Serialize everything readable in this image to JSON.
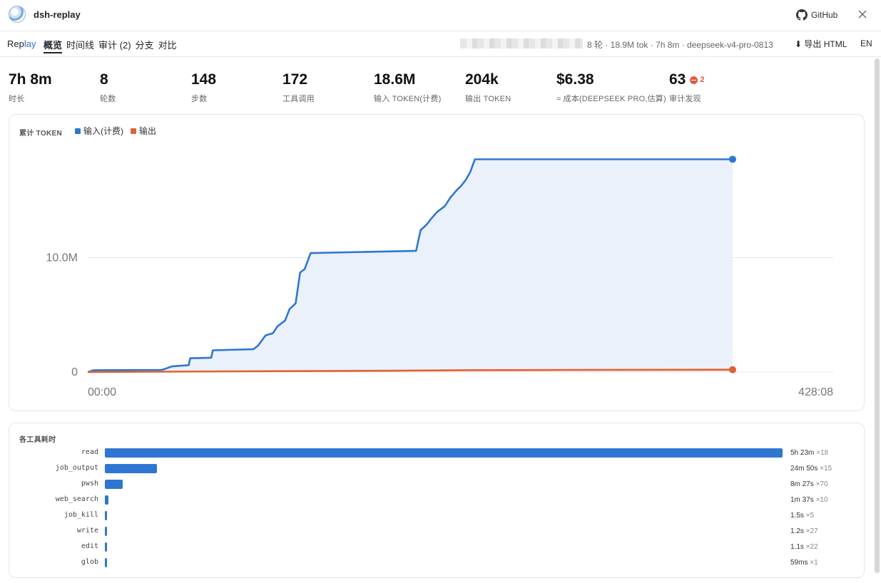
{
  "app": {
    "title": "dsh-replay",
    "github_label": "GitHub"
  },
  "nav": {
    "brand_prefix": "Rep",
    "brand_suffix": "lay",
    "tabs": [
      {
        "label": "概览",
        "active": true
      },
      {
        "label": "时间线",
        "active": false
      },
      {
        "label": "审计 (2)",
        "active": false
      },
      {
        "label": "分支",
        "active": false
      },
      {
        "label": "对比",
        "active": false
      }
    ],
    "session_info": "8 轮 · 18.9M tok · 7h 8m · deepseek-v4-pro-0813",
    "export_label": "⬇ 导出 HTML",
    "lang_label": "EN"
  },
  "stats": [
    {
      "value": "7h 8m",
      "label": "时长"
    },
    {
      "value": "8",
      "label": "轮数"
    },
    {
      "value": "148",
      "label": "步数"
    },
    {
      "value": "172",
      "label": "工具调用"
    },
    {
      "value": "18.6M",
      "label": "输入 TOKEN(计费)"
    },
    {
      "value": "204k",
      "label": "输出 TOKEN"
    },
    {
      "value": "$6.38",
      "label": "≈ 成本(DEEPSEEK PRO,估算)"
    },
    {
      "value": "63",
      "label": "审计发现",
      "badge": "2"
    }
  ],
  "chart_panel": {
    "title": "累计 TOKEN"
  },
  "chart_data": {
    "type": "area",
    "x_range_minutes": [
      0,
      428.133
    ],
    "x_tick_labels": [
      "00:00",
      "428:08"
    ],
    "y_range": [
      0,
      20000000
    ],
    "y_ticks": [
      0,
      10000000
    ],
    "y_tick_labels": [
      "0",
      "10.0M"
    ],
    "grid": true,
    "legend_placement": "top-left",
    "series": [
      {
        "name": "输入(计费)",
        "color": "#2f76d2",
        "fill": "#e8f0fa",
        "points": [
          [
            0,
            0
          ],
          [
            4,
            160000
          ],
          [
            49,
            190000
          ],
          [
            51,
            260000
          ],
          [
            56,
            500000
          ],
          [
            67,
            600000
          ],
          [
            68,
            1200000
          ],
          [
            82,
            1250000
          ],
          [
            83,
            1900000
          ],
          [
            110,
            2000000
          ],
          [
            113,
            2300000
          ],
          [
            118,
            3200000
          ],
          [
            123,
            3400000
          ],
          [
            126,
            4000000
          ],
          [
            131,
            4500000
          ],
          [
            134,
            5500000
          ],
          [
            138,
            6000000
          ],
          [
            141,
            8700000
          ],
          [
            144,
            9000000
          ],
          [
            148,
            10400000
          ],
          [
            218,
            10600000
          ],
          [
            221,
            12400000
          ],
          [
            225,
            12900000
          ],
          [
            228,
            13400000
          ],
          [
            232,
            14000000
          ],
          [
            237,
            14500000
          ],
          [
            241,
            15300000
          ],
          [
            245,
            15900000
          ],
          [
            248,
            16300000
          ],
          [
            251,
            16800000
          ],
          [
            254,
            17500000
          ],
          [
            257,
            18600000
          ],
          [
            428.133,
            18600000
          ]
        ]
      },
      {
        "name": "输出",
        "color": "#e06234",
        "fill": "#fbe9e3",
        "points": [
          [
            0,
            0
          ],
          [
            100,
            60000
          ],
          [
            200,
            110000
          ],
          [
            250,
            160000
          ],
          [
            340,
            190000
          ],
          [
            428.133,
            204000
          ]
        ]
      }
    ]
  },
  "tools_panel": {
    "title": "各工具耗时",
    "items": [
      {
        "name": "read",
        "seconds": 19380,
        "duration": "5h 23m",
        "count": "×18"
      },
      {
        "name": "job_output",
        "seconds": 1490,
        "duration": "24m 50s",
        "count": "×15"
      },
      {
        "name": "pwsh",
        "seconds": 507,
        "duration": "8m 27s",
        "count": "×70"
      },
      {
        "name": "web_search",
        "seconds": 97,
        "duration": "1m 37s",
        "count": "×10"
      },
      {
        "name": "job_kill",
        "seconds": 1.5,
        "duration": "1.5s",
        "count": "×5"
      },
      {
        "name": "write",
        "seconds": 1.2,
        "duration": "1.2s",
        "count": "×27"
      },
      {
        "name": "edit",
        "seconds": 1.1,
        "duration": "1.1s",
        "count": "×22"
      },
      {
        "name": "glob",
        "seconds": 0.059,
        "duration": "59ms",
        "count": "×1"
      }
    ]
  }
}
